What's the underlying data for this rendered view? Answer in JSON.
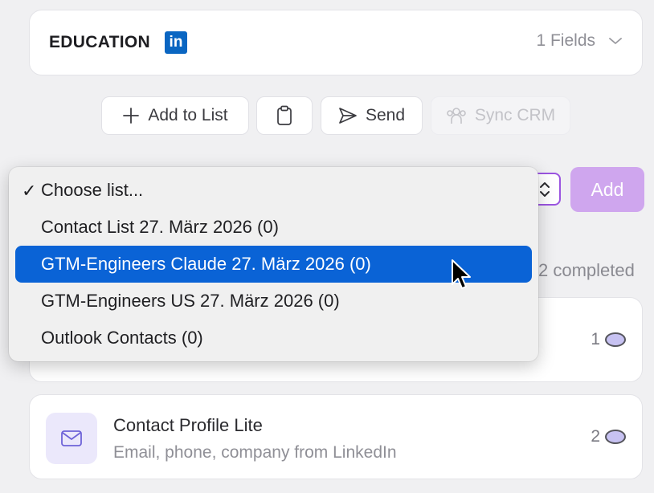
{
  "education": {
    "title": "EDUCATION",
    "linkedin_badge": "in",
    "fields": "1 Fields"
  },
  "toolbar": {
    "add_to_list": "Add to List",
    "send": "Send",
    "sync_crm": "Sync CRM"
  },
  "list_add": {
    "add_label": "Add"
  },
  "progress": {
    "completed_text": "2 completed"
  },
  "dropdown": {
    "options": [
      {
        "label": "Choose list...",
        "checked": true
      },
      {
        "label": "Contact List 27. März 2026 (0)"
      },
      {
        "label": "GTM-Engineers Claude 27. März 2026 (0)",
        "highlighted": true
      },
      {
        "label": "GTM-Engineers US 27. März 2026 (0)"
      },
      {
        "label": "Outlook Contacts (0)"
      }
    ],
    "check_mark": "✓"
  },
  "enrichments": [
    {
      "title": "",
      "subtitle": "",
      "credits": "1"
    },
    {
      "title": "Contact Profile Lite",
      "subtitle": "Email, phone, company from LinkedIn",
      "credits": "2",
      "icon": "mail-icon"
    }
  ],
  "colors": {
    "accent": "#9b55e0",
    "add_button": "#cfa6ee",
    "highlight": "#0a63d6",
    "linkedin": "#0a66c2"
  }
}
